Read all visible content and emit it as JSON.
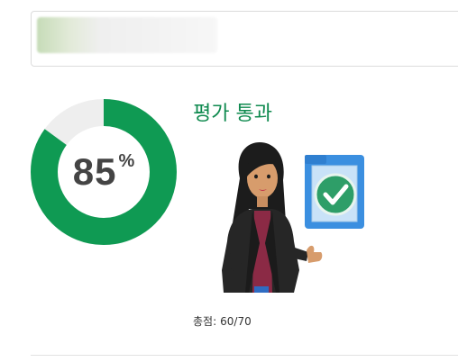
{
  "result": {
    "percent": 85,
    "percent_text": "85",
    "percent_unit": "%",
    "title": "평가 통과",
    "total_label": "총점:",
    "total_value": "60/70"
  },
  "colors": {
    "ring_fill": "#0f9a53",
    "ring_track": "#eeeeee",
    "title": "#0f8a4f",
    "check_badge": "#2e9e68",
    "clipboard": "#3b8fe0"
  },
  "icons": {
    "illustration": "person-with-checklist",
    "badge": "check-circle-icon"
  }
}
